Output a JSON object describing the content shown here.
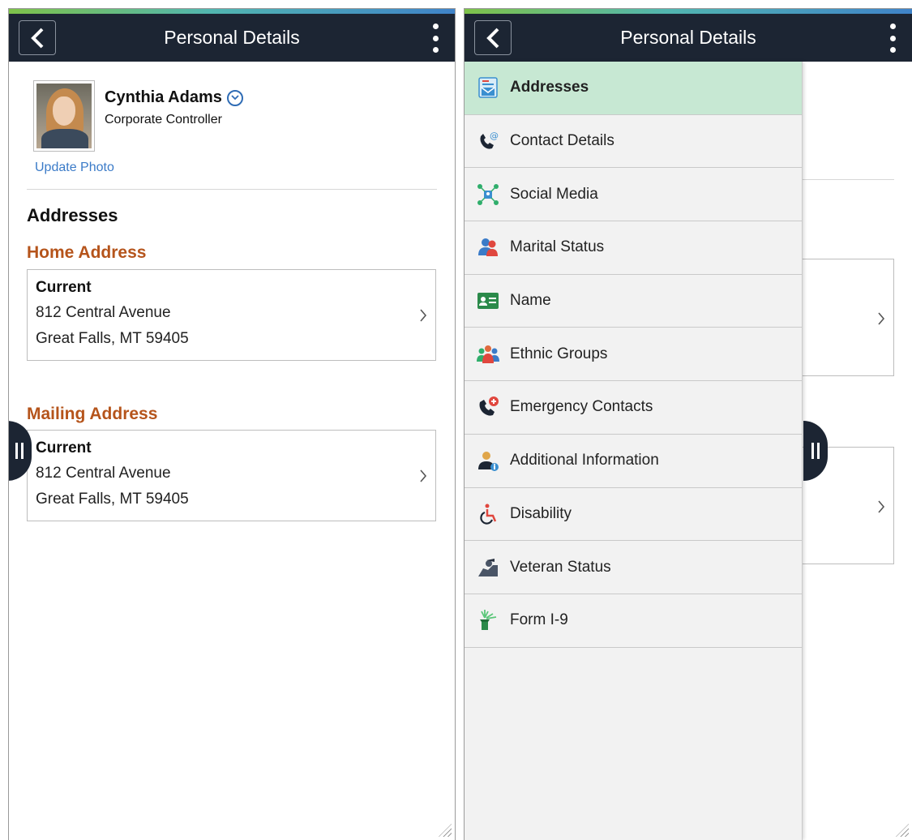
{
  "header": {
    "title": "Personal Details"
  },
  "profile": {
    "name": "Cynthia Adams",
    "job_title": "Corporate Controller",
    "update_photo": "Update Photo"
  },
  "content": {
    "section_title": "Addresses",
    "addresses": [
      {
        "type": "Home Address",
        "status": "Current",
        "line1": "812 Central Avenue",
        "line2": "Great Falls, MT 59405"
      },
      {
        "type": "Mailing Address",
        "status": "Current",
        "line1": "812 Central Avenue",
        "line2": "Great Falls, MT 59405"
      }
    ]
  },
  "menu": {
    "items": [
      {
        "label": "Addresses",
        "icon": "address-card-icon",
        "active": true
      },
      {
        "label": "Contact Details",
        "icon": "phone-email-icon",
        "active": false
      },
      {
        "label": "Social Media",
        "icon": "social-network-icon",
        "active": false
      },
      {
        "label": "Marital Status",
        "icon": "couple-icon",
        "active": false
      },
      {
        "label": "Name",
        "icon": "name-card-icon",
        "active": false
      },
      {
        "label": "Ethnic Groups",
        "icon": "group-icon",
        "active": false
      },
      {
        "label": "Emergency Contacts",
        "icon": "emergency-phone-icon",
        "active": false
      },
      {
        "label": "Additional Information",
        "icon": "person-info-icon",
        "active": false
      },
      {
        "label": "Disability",
        "icon": "wheelchair-icon",
        "active": false
      },
      {
        "label": "Veteran Status",
        "icon": "veteran-salute-icon",
        "active": false
      },
      {
        "label": "Form I-9",
        "icon": "liberty-torch-icon",
        "active": false
      }
    ]
  },
  "colors": {
    "header_bg": "#1c2533",
    "section_accent": "#b5541b",
    "link": "#3b7bc8",
    "active_menu_bg": "#c7e8d3"
  }
}
